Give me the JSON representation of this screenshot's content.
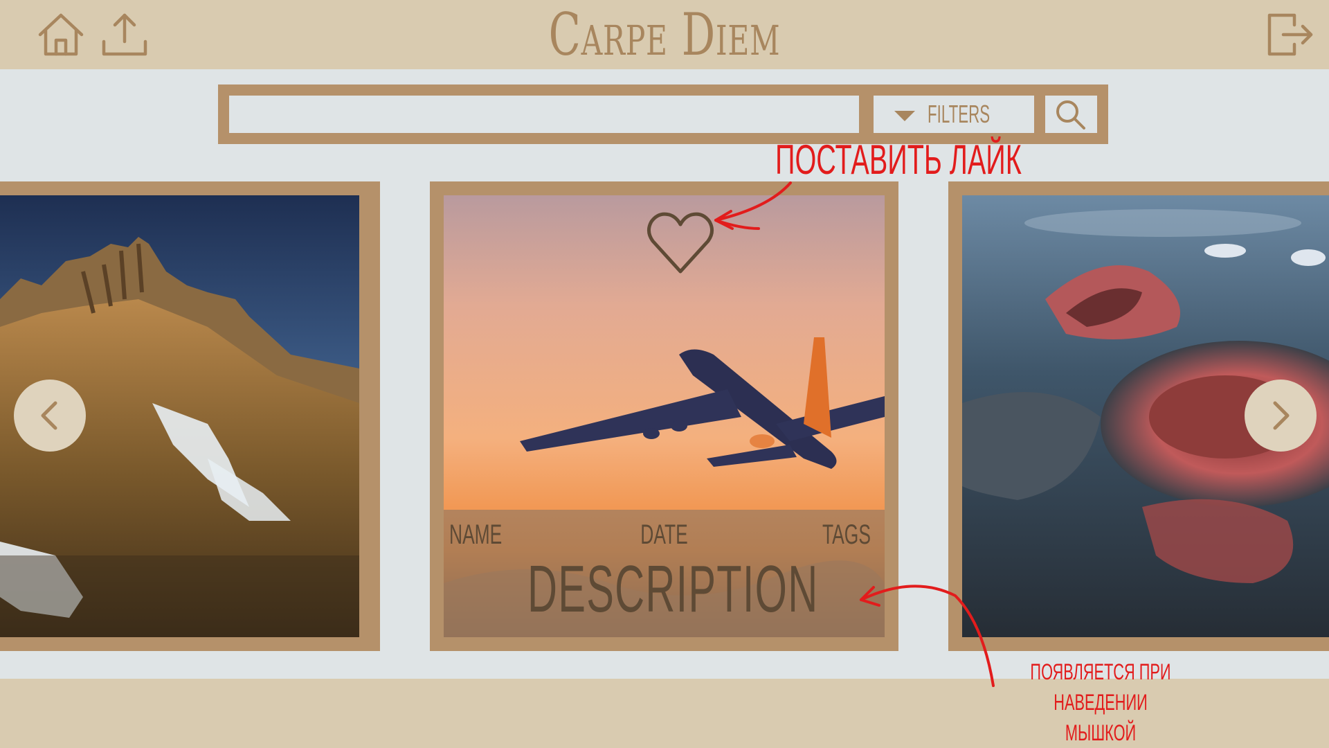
{
  "header": {
    "title": "Carpe Diem",
    "icons": [
      "home-icon",
      "upload-icon",
      "logout-icon"
    ]
  },
  "search": {
    "value": "",
    "placeholder": "",
    "filters_label": "FILTERS",
    "icons": [
      "dropdown-arrow-icon",
      "search-icon"
    ]
  },
  "featured_card": {
    "name_label": "NAME",
    "date_label": "DATE",
    "tags_label": "TAGS",
    "description_label": "DESCRIPTION",
    "like_icon": "heart-icon"
  },
  "carousel": {
    "prev_icon": "chevron-left-icon",
    "next_icon": "chevron-right-icon"
  },
  "annotations": {
    "like": "ПОСТАВИТЬ ЛАЙК",
    "hover_line1": "появляется при наведении",
    "hover_line2": "мышкой"
  },
  "colors": {
    "header_bg": "#d9cbb0",
    "main_bg": "#dfe4e6",
    "frame": "#b5916a",
    "title": "#a8865e",
    "overlay_text": "#5e4a35",
    "annotation": "#e21c1c"
  }
}
